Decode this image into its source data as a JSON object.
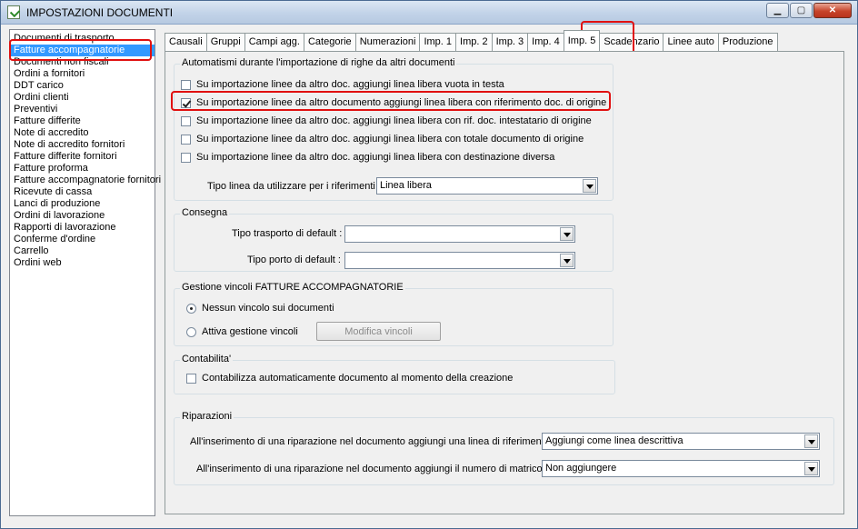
{
  "window": {
    "title": "IMPOSTAZIONI DOCUMENTI",
    "minimize": "▁",
    "maximize": "▢",
    "close": "✕"
  },
  "doc_list": [
    "Documenti di trasporto",
    "Fatture accompagnatorie",
    "Documenti non fiscali",
    "Ordini a fornitori",
    "DDT carico",
    "Ordini clienti",
    "Preventivi",
    "Fatture differite",
    "Note di accredito",
    "Note di accredito fornitori",
    "Fatture differite fornitori",
    "Fatture proforma",
    "Fatture accompagnatorie fornitori",
    "Ricevute di cassa",
    "Lanci di produzione",
    "Ordini di lavorazione",
    "Rapporti di lavorazione",
    "Conferme d'ordine",
    "Carrello",
    "Ordini web"
  ],
  "selected_doc_index": 1,
  "tabs": [
    "Causali",
    "Gruppi",
    "Campi agg.",
    "Categorie",
    "Numerazioni",
    "Imp. 1",
    "Imp. 2",
    "Imp. 3",
    "Imp. 4",
    "Imp. 5",
    "Scadenzario",
    "Linee auto",
    "Produzione"
  ],
  "active_tab_index": 9,
  "automatismi": {
    "title": "Automatismi durante l'importazione di righe da altri documenti",
    "options": [
      {
        "label": "Su importazione linee da altro doc. aggiungi linea libera vuota in testa",
        "checked": false
      },
      {
        "label": "Su importazione linee da altro documento aggiungi linea libera con riferimento doc. di origine",
        "checked": true
      },
      {
        "label": "Su importazione linee da altro doc. aggiungi linea libera con rif. doc. intestatario di origine",
        "checked": false
      },
      {
        "label": "Su importazione linee da altro doc. aggiungi linea libera con totale documento di origine",
        "checked": false
      },
      {
        "label": "Su importazione linee da altro doc. aggiungi linea libera con destinazione diversa",
        "checked": false
      }
    ],
    "tipo_linea_label": "Tipo linea da utilizzare per i riferimenti :",
    "tipo_linea_value": "Linea libera"
  },
  "consegna": {
    "title": "Consegna",
    "trasporto_label": "Tipo trasporto di default :",
    "trasporto_value": "",
    "porto_label": "Tipo porto di default :",
    "porto_value": ""
  },
  "vincoli": {
    "title": "Gestione vincoli FATTURE ACCOMPAGNATORIE",
    "nessuno_label": "Nessun vincolo sui documenti",
    "attiva_label": "Attiva gestione vincoli",
    "selected": "nessuno",
    "modifica_label": "Modifica vincoli"
  },
  "contabilita": {
    "title": "Contabilita'",
    "option_label": "Contabilizza automaticamente documento al momento della creazione",
    "checked": false
  },
  "riparazioni": {
    "title": "Riparazioni",
    "linea_label": "All'inserimento di una riparazione nel documento aggiungi una linea di riferimento :",
    "linea_value": "Aggiungi come linea descrittiva",
    "matricola_label": "All'inserimento di una riparazione nel documento aggiungi il numero di matricola :",
    "matricola_value": "Non aggiungere"
  },
  "colors": {
    "highlight": "#e01010",
    "selection": "#3399ff"
  }
}
